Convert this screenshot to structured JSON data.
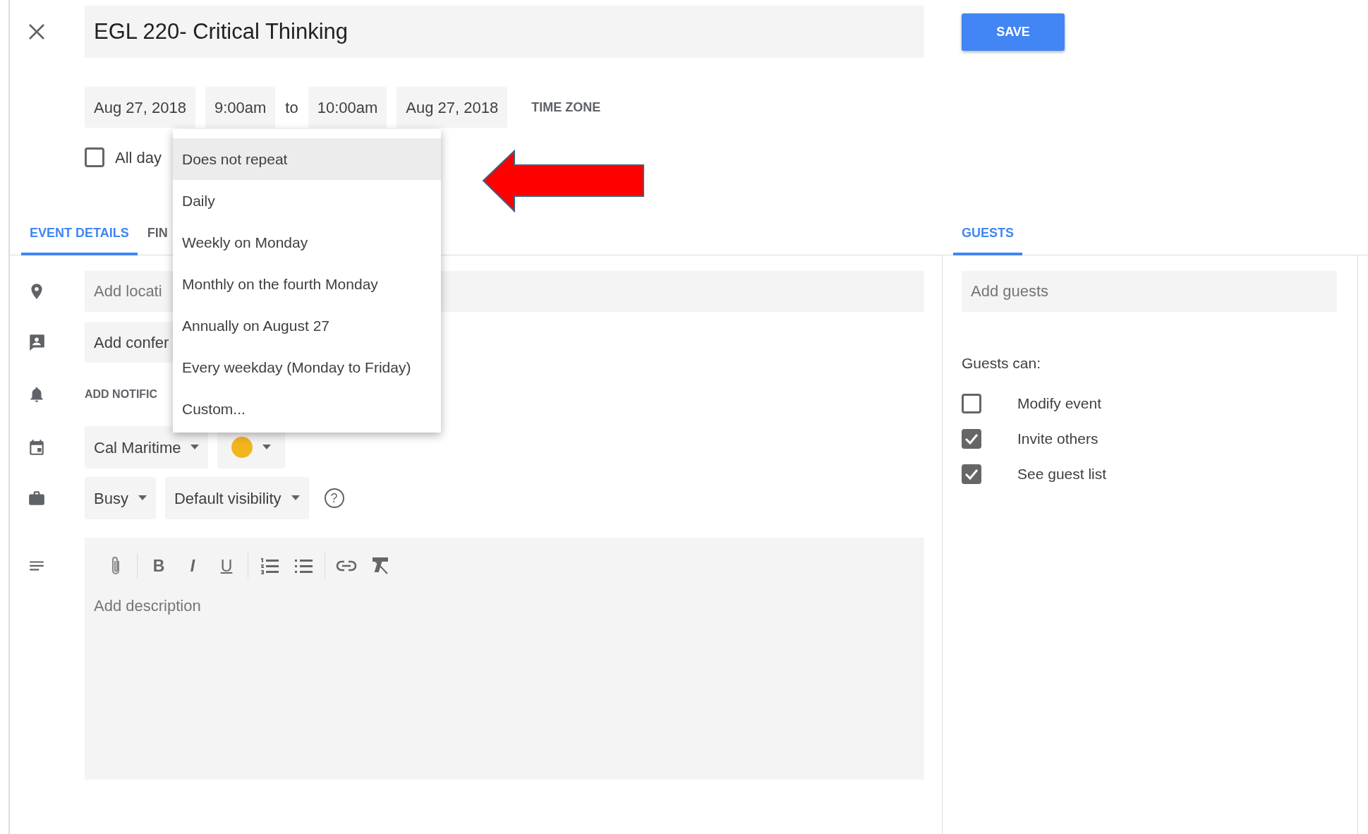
{
  "title": "EGL 220- Critical Thinking",
  "save_button": "SAVE",
  "date_time": {
    "start_date": "Aug 27, 2018",
    "start_time": "9:00am",
    "separator": "to",
    "end_time": "10:00am",
    "end_date": "Aug 27, 2018",
    "time_zone": "TIME ZONE"
  },
  "all_day": {
    "label": "All day",
    "checked": false
  },
  "repeat_menu": {
    "items": [
      {
        "label": "Does not repeat",
        "selected": true
      },
      {
        "label": "Daily",
        "selected": false
      },
      {
        "label": "Weekly on Monday",
        "selected": false
      },
      {
        "label": "Monthly on the fourth Monday",
        "selected": false
      },
      {
        "label": "Annually on August 27",
        "selected": false
      },
      {
        "label": "Every weekday (Monday to Friday)",
        "selected": false
      },
      {
        "label": "Custom...",
        "selected": false
      }
    ]
  },
  "tabs": [
    {
      "label": "EVENT DETAILS",
      "selected": true
    },
    {
      "label": "FIN",
      "selected": false
    },
    {
      "label": "GUESTS",
      "selected": true
    }
  ],
  "event_details": {
    "location": {
      "placeholder": "Add locati"
    },
    "conferencing": "Add confer",
    "notification": "ADD NOTIFIC",
    "calendar": "Cal Maritime",
    "color": "#f2b51e",
    "availability": "Busy",
    "visibility": "Default visibility",
    "help": "?",
    "formatting": [
      "B",
      "I",
      "U"
    ],
    "description": {
      "placeholder": "Add description"
    }
  },
  "guests": {
    "add": {
      "placeholder": "Add guests"
    },
    "permissions_title": "Guests can:",
    "permissions": [
      {
        "label": "Modify event",
        "checked": false
      },
      {
        "label": "Invite others",
        "checked": true
      },
      {
        "label": "See guest list",
        "checked": true
      }
    ]
  }
}
